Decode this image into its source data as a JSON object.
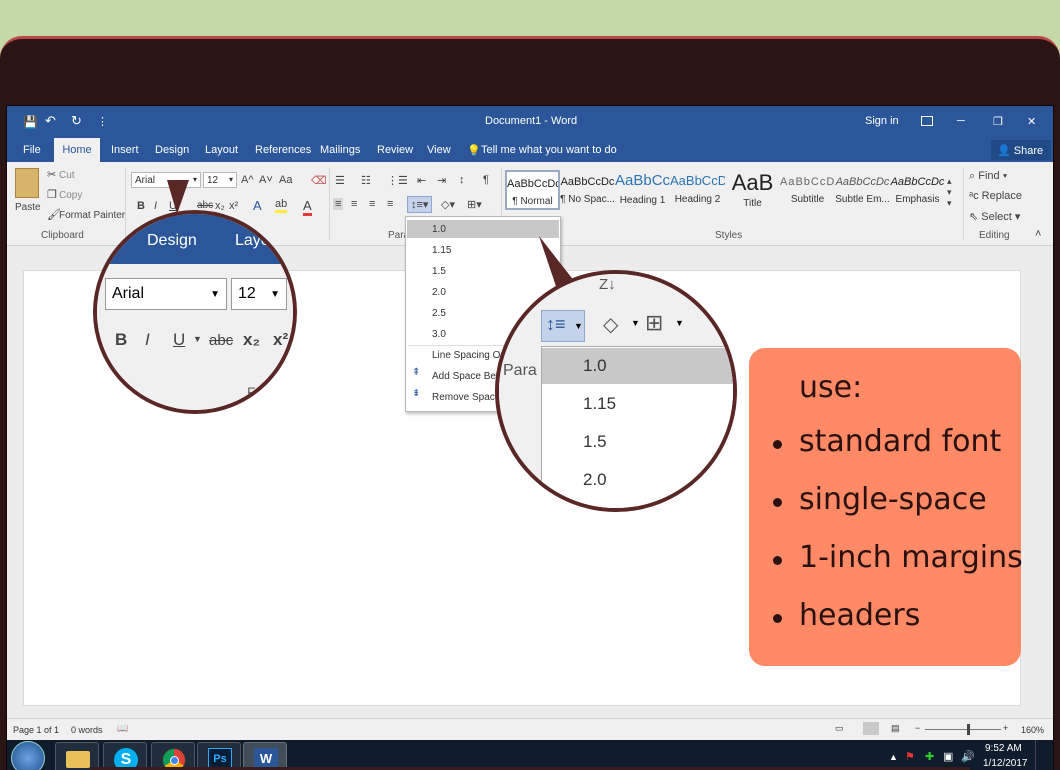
{
  "window": {
    "title": "Document1  -  Word",
    "sign_in": "Sign in",
    "share": "Share",
    "minimize": "─",
    "maximize": "❐",
    "close": "✕"
  },
  "quick_access": {
    "save": "💾",
    "undo": "↶",
    "redo": "↻",
    "more": "⋮"
  },
  "tabs": [
    "File",
    "Home",
    "Insert",
    "Design",
    "Layout",
    "References",
    "Mailings",
    "Review",
    "View"
  ],
  "tell_me": "Tell me what you want to do",
  "clipboard": {
    "paste": "Paste",
    "cut": "Cut",
    "copy": "Copy",
    "format_painter": "Format Painter",
    "label": "Clipboard"
  },
  "font": {
    "name": "Arial",
    "size": "12",
    "bold": "B",
    "italic": "I",
    "underline": "U",
    "strike": "abc",
    "sub": "x₂",
    "sup": "x²",
    "grow": "A^",
    "shrink": "A˅",
    "case": "Aa"
  },
  "paragraph": {
    "label": "Paragraph",
    "label_visible": "Para"
  },
  "styles": {
    "label": "Styles",
    "items": [
      {
        "preview": "AaBbCcDc",
        "name": "¶ Normal"
      },
      {
        "preview": "AaBbCcDc",
        "name": "¶ No Spac..."
      },
      {
        "preview": "AaBbCc",
        "name": "Heading 1"
      },
      {
        "preview": "AaBbCcD",
        "name": "Heading 2"
      },
      {
        "preview": "AaB",
        "name": "Title"
      },
      {
        "preview": "AaBbCcD",
        "name": "Subtitle"
      },
      {
        "preview": "AaBbCcDc",
        "name": "Subtle Em..."
      },
      {
        "preview": "AaBbCcDc",
        "name": "Emphasis"
      }
    ]
  },
  "editing": {
    "find": "Find",
    "replace": "Replace",
    "select": "Select",
    "label": "Editing"
  },
  "line_spacing_menu": {
    "options": [
      "1.0",
      "1.15",
      "1.5",
      "2.0",
      "2.5",
      "3.0"
    ],
    "selected": "1.0",
    "line_spacing_options": "Line Spacing Op",
    "add_space": "Add Space Befo",
    "remove_space": "Remove Space"
  },
  "zoom_font": {
    "tab_design": "Design",
    "tab_layout": "Layo",
    "font_name": "Arial",
    "font_size": "12",
    "bold": "B",
    "italic": "I",
    "underline": "U",
    "strike": "abc",
    "sub": "x₂",
    "sup": "x²",
    "para_partial": "F"
  },
  "zoom_spacing": {
    "options": [
      "1.0",
      "1.15",
      "1.5",
      "2.0"
    ],
    "para": "Para",
    "top_partial": "Z↓"
  },
  "status": {
    "page": "Page 1 of 1",
    "words": "0 words",
    "zoom": "160%"
  },
  "taskbar": {
    "time": "9:52 AM",
    "date": "1/12/2017",
    "apps": [
      "File Explorer",
      "Skype",
      "Chrome",
      "Photoshop",
      "Word"
    ],
    "ps": "Ps",
    "word": "W",
    "skype": "S"
  },
  "note": {
    "heading": "use:",
    "items": [
      "standard font",
      "single-space",
      "1-inch margins",
      "headers"
    ]
  },
  "colors": {
    "word_blue": "#2b579a",
    "note_bg": "#ff8a65",
    "lens_border": "#5a2727"
  }
}
